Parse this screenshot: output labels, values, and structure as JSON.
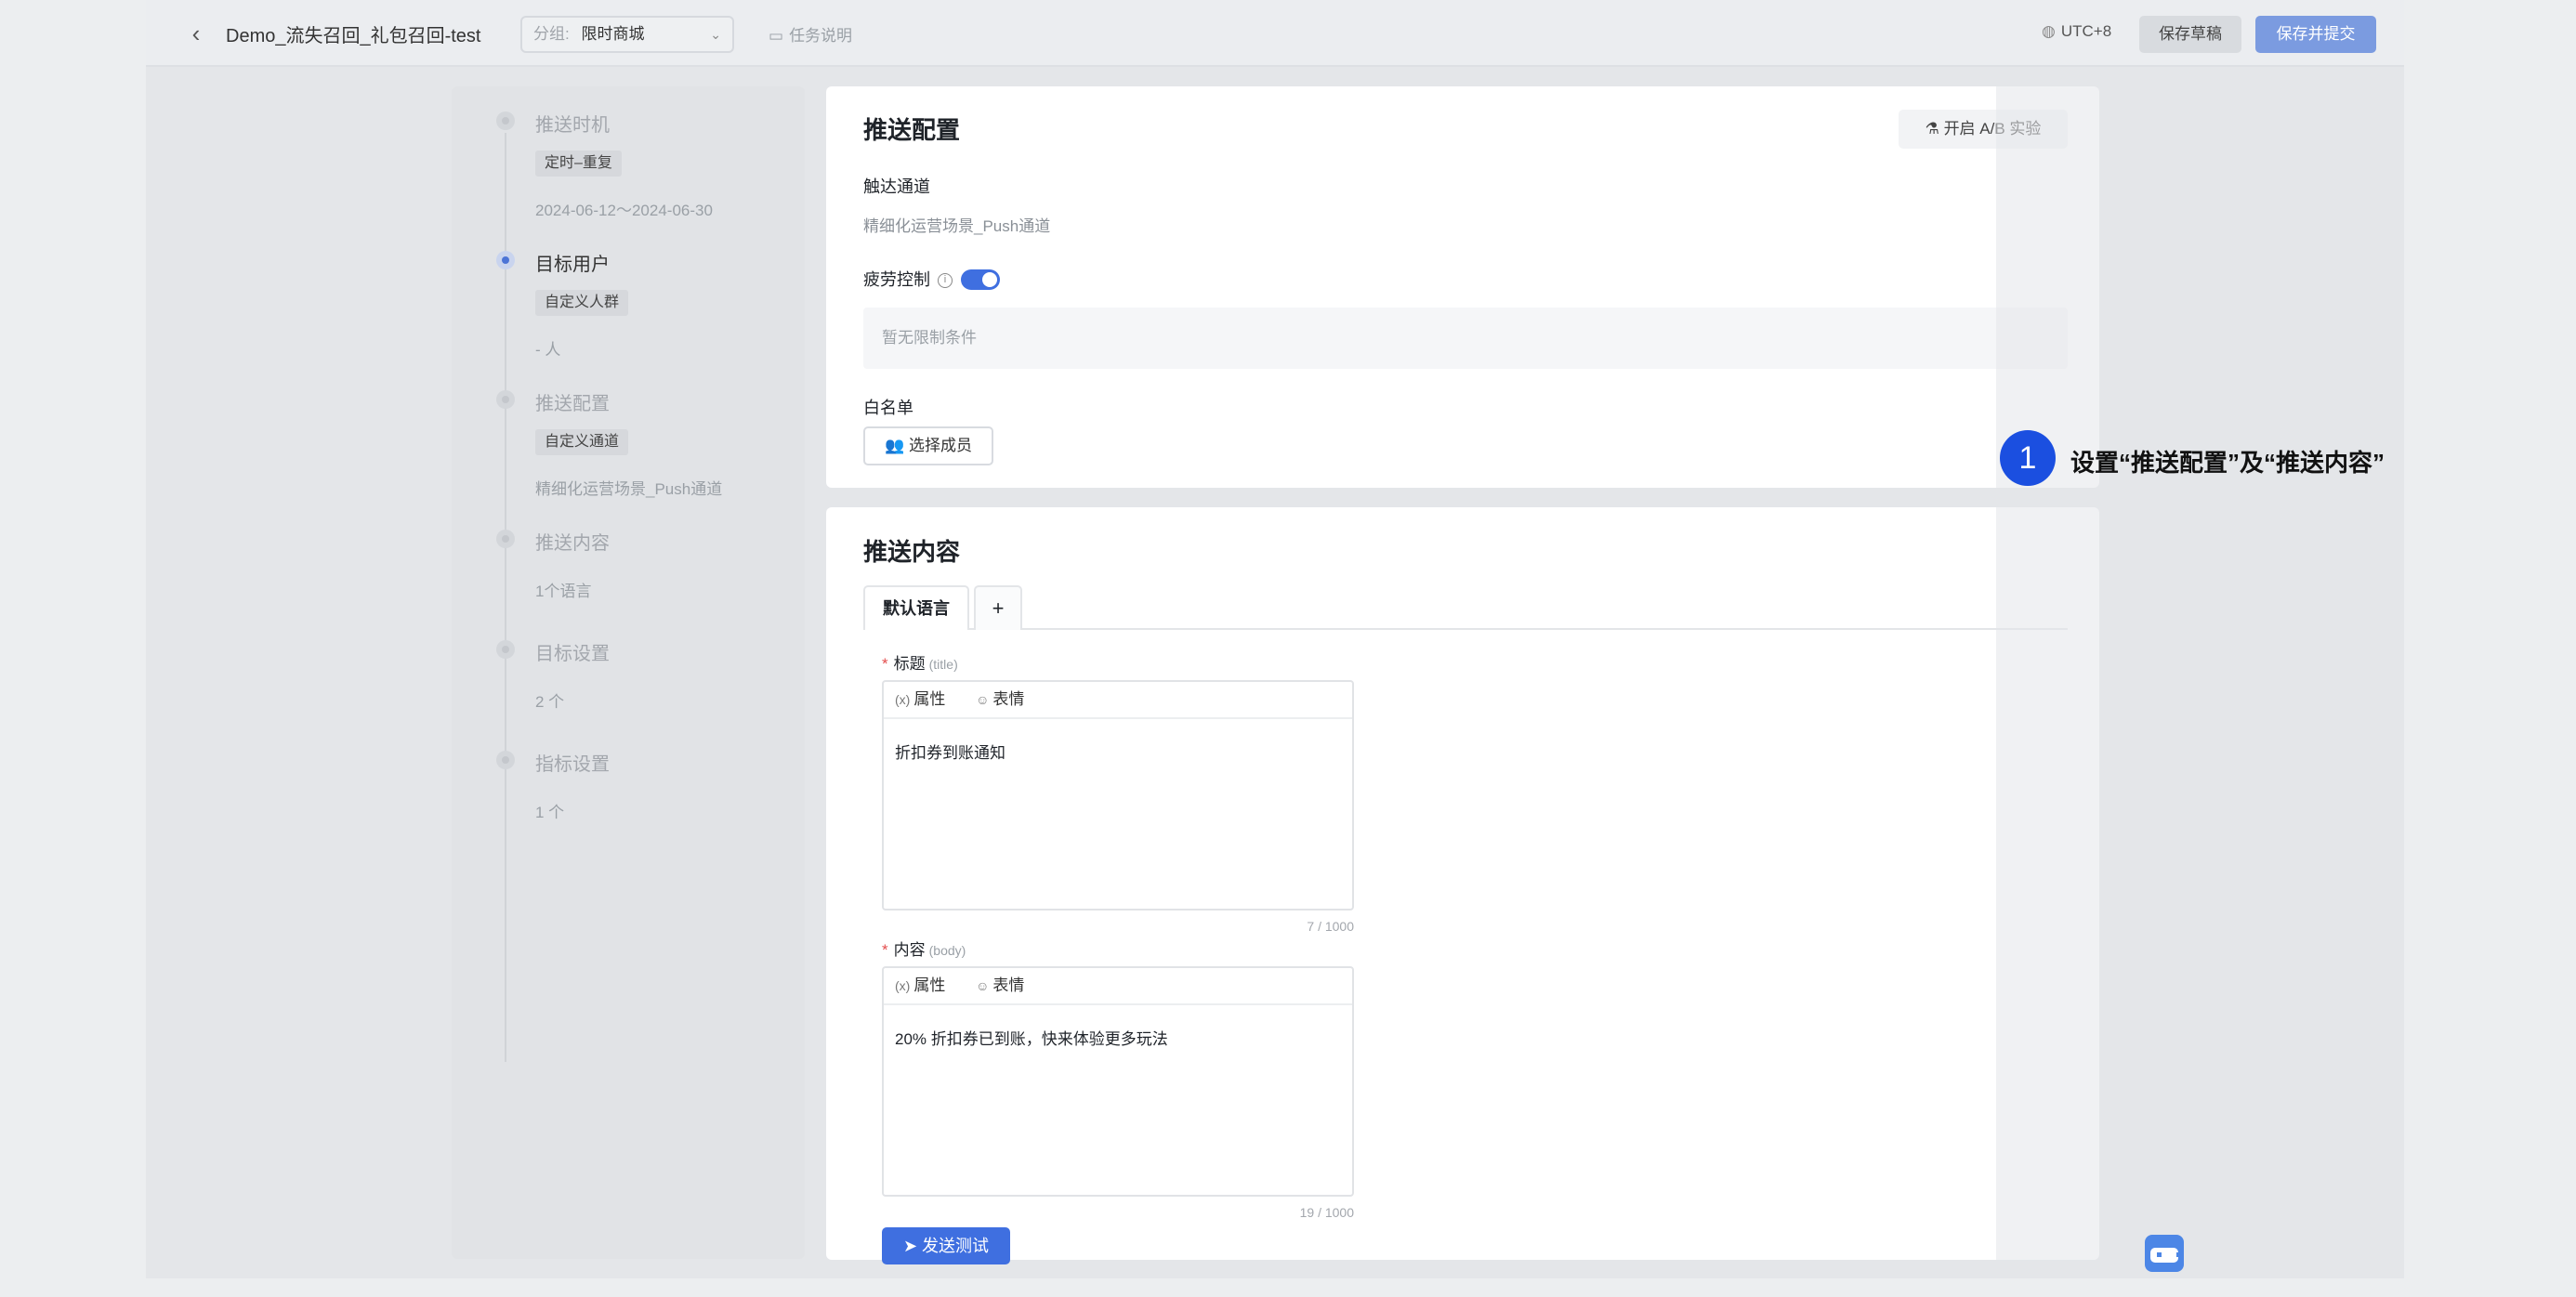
{
  "header": {
    "back_label": "‹",
    "task_title": "Demo_流失召回_礼包召回-test",
    "group_prefix": "分组:",
    "group_value": "限时商城",
    "task_desc": "任务说明",
    "timezone": "UTC+8",
    "save_draft": "保存草稿",
    "save_submit": "保存并提交"
  },
  "steps": [
    {
      "title": "推送时机",
      "tag": "定时–重复",
      "sub": "2024-06-12～2024-06-30",
      "active": false
    },
    {
      "title": "目标用户",
      "tag": "自定义人群",
      "sub": "- 人",
      "active": true
    },
    {
      "title": "推送配置",
      "tag": "自定义通道",
      "sub": "精细化运营场景_Push通道",
      "active": false
    },
    {
      "title": "推送内容",
      "tag": "",
      "sub": "1个语言",
      "active": false
    },
    {
      "title": "目标设置",
      "tag": "",
      "sub": "2 个",
      "active": false
    },
    {
      "title": "指标设置",
      "tag": "",
      "sub": "1 个",
      "active": false
    }
  ],
  "config": {
    "title": "推送配置",
    "ab_button": "开启 A/B 实验",
    "channel_label": "触达通道",
    "channel_value": "精细化运营场景_Push通道",
    "fatigue_label": "疲劳控制",
    "fatigue_on": true,
    "fatigue_empty": "暂无限制条件",
    "whitelist_label": "白名单",
    "select_members": "选择成员"
  },
  "content": {
    "title": "推送内容",
    "tab_default": "默认语言",
    "tab_add": "+",
    "title_label": "标题",
    "title_hint": "(title)",
    "body_label": "内容",
    "body_hint": "(body)",
    "toolbar_attr": "属性",
    "toolbar_emoji": "表情",
    "title_text": "折扣券到账通知",
    "title_count": "7 / 1000",
    "body_text": "20% 折扣券已到账，快来体验更多玩法",
    "body_count": "19 / 1000",
    "send_test": "发送测试"
  },
  "annotation": {
    "number": "1",
    "text": "设置“推送配置”及“推送内容”"
  },
  "colors": {
    "accent": "#3f6fe0",
    "badge": "#1b4fe0",
    "required": "#e34d4d"
  }
}
